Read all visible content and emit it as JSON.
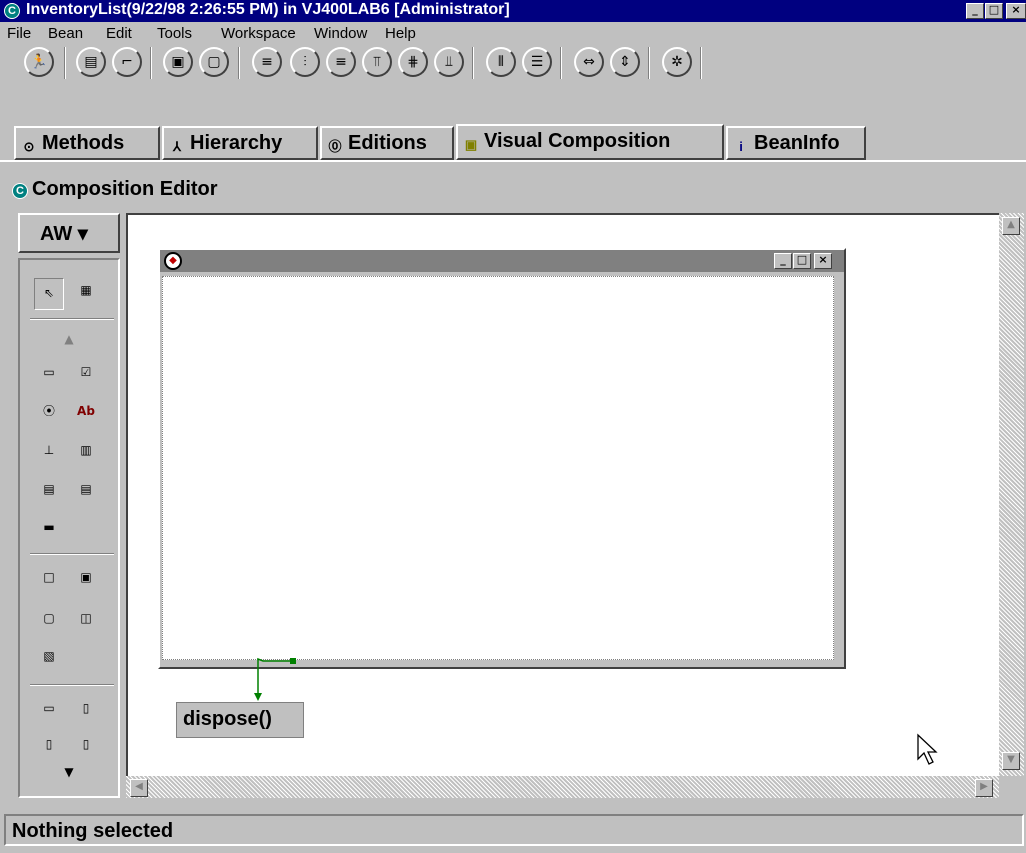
{
  "window": {
    "title": "InventoryList(9/22/98 2:26:55 PM) in VJ400LAB6 [Administrator]",
    "app_icon_letter": "C",
    "controls": [
      "_",
      "□",
      "×"
    ]
  },
  "menu": {
    "items": [
      "File",
      "Bean",
      "Edit",
      "Tools",
      "Workspace",
      "Window",
      "Help"
    ]
  },
  "tabs": {
    "methods": "Methods",
    "hierarchy": "Hierarchy",
    "editions": "Editions",
    "visual_composition": "Visual Composition",
    "beaninfo": "BeanInfo"
  },
  "editor": {
    "title": "Composition Editor",
    "palette_category": "AW ▾"
  },
  "canvas": {
    "connection_label": "dispose()"
  },
  "status": {
    "text": "Nothing selected"
  },
  "colors": {
    "titlebar": "#000080",
    "face": "#c0c0c0",
    "connection": "#008000",
    "canvas": "#ffffff"
  }
}
